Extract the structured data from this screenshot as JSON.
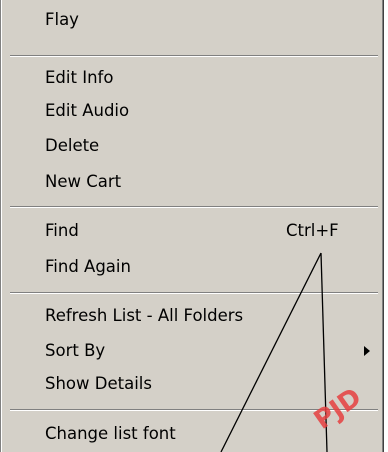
{
  "menu": {
    "groups": [
      {
        "items": [
          {
            "label": "Flay"
          }
        ]
      },
      {
        "items": [
          {
            "label": "Edit Info"
          },
          {
            "label": "Edit Audio"
          },
          {
            "label": "Delete"
          },
          {
            "label": "New Cart"
          }
        ]
      },
      {
        "items": [
          {
            "label": "Find",
            "shortcut": "Ctrl+F"
          },
          {
            "label": "Find Again"
          }
        ]
      },
      {
        "items": [
          {
            "label": "Refresh List - All Folders"
          },
          {
            "label": "Sort By",
            "has_submenu": true
          },
          {
            "label": "Show Details"
          }
        ]
      },
      {
        "items": [
          {
            "label": "Change list font"
          }
        ]
      }
    ]
  },
  "watermark": {
    "text": "PJD",
    "color": "#e64040"
  },
  "colors": {
    "menu_bg": "#d4d0c8",
    "separator_dark": "#808080",
    "separator_light": "#ffffff",
    "text": "#000000"
  }
}
